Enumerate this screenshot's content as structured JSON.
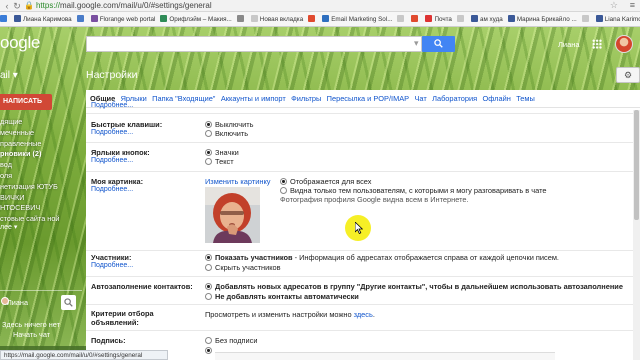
{
  "browser": {
    "url_proto": "https://",
    "url_rest": "mail.google.com/mail/u/0/#settings/general",
    "bookmarks": [
      {
        "label": "",
        "color": "#3b7dd8"
      },
      {
        "label": "Лиана Каримова",
        "color": "#3b5998"
      },
      {
        "label": "",
        "color": "#4a7cc8"
      },
      {
        "label": "Florange web portal",
        "color": "#7a4fa0"
      },
      {
        "label": "Орифлэйм – Макия...",
        "color": "#2e8b57"
      },
      {
        "label": "",
        "color": "#8a8a8a"
      },
      {
        "label": "Новая вкладка",
        "color": "#c8c8c8"
      },
      {
        "label": "",
        "color": "#e04a2f"
      },
      {
        "label": "Email Marketing Sol...",
        "color": "#2e6fbf"
      },
      {
        "label": "",
        "color": "#c8c8c8"
      },
      {
        "label": "",
        "color": "#e04a2f"
      },
      {
        "label": "Почта",
        "color": "#d33"
      },
      {
        "label": "",
        "color": "#c8c8c8"
      },
      {
        "label": "ам худа",
        "color": "#3b5998"
      },
      {
        "label": "Марина Брикайло ...",
        "color": "#3b5998"
      },
      {
        "label": "",
        "color": "#c8c8c8"
      },
      {
        "label": "Liana Karimova",
        "color": "#3b5998"
      }
    ],
    "status_url": "https://mail.google.com/mail/u/0/#settings/general"
  },
  "header": {
    "logo": "oogle",
    "user_name": "Лиана",
    "mail_label": "ail ▾",
    "page_title": "Настройки"
  },
  "sidebar": {
    "compose_label": "НАПИСАТЬ",
    "items": [
      {
        "label": "дящие",
        "bold": false
      },
      {
        "label": "меченные",
        "bold": false
      },
      {
        "label": "правленные",
        "bold": false
      },
      {
        "label": "рновики (2)",
        "bold": true
      },
      {
        "label": "вод",
        "bold": false
      },
      {
        "label": "оля",
        "bold": false
      },
      {
        "label": "нетизация ЮТУБ",
        "bold": false
      },
      {
        "label": "ВИЧКИ",
        "bold": false
      },
      {
        "label": "НТОСЕВИЧ",
        "bold": false
      },
      {
        "label": "стовые сайта ной",
        "bold": false
      }
    ],
    "more_label": "лее ▾",
    "hangout_name": "Лиана",
    "nobody_text": "Здесь ничего нет",
    "start_chat": "Начать чат"
  },
  "settings": {
    "tabs": [
      "Общие",
      "Ярлыки",
      "Папка \"Входящие\"",
      "Аккаунты и импорт",
      "Фильтры",
      "Пересылка и POP/IMAP",
      "Чат",
      "Лаборатория",
      "Офлайн",
      "Темы"
    ],
    "more_label": "Подробнее...",
    "rows": {
      "shortcuts": {
        "label": "Быстрые клавиши:",
        "options": [
          "Выключить",
          "Включить"
        ]
      },
      "button_labels": {
        "label": "Ярлыки кнопок:",
        "options": [
          "Значки",
          "Текст"
        ]
      },
      "picture": {
        "label": "Моя картинка:",
        "change_link": "Изменить картинку",
        "option1": "Отображается для всех",
        "option2": "Видна только тем пользователям, с которыми я могу разговаривать в чате",
        "note": "Фотография профиля Google видна всем в Интернете."
      },
      "participants": {
        "label": "Участники:",
        "option1_bold": "Показать участников",
        "option1_rest": " - Информация об адресатах отображается справа от каждой цепочки писем.",
        "option2": "Скрыть участников"
      },
      "autocomplete": {
        "label": "Автозаполнение контактов:",
        "option1": "Добавлять новых адресатов в группу \"Другие контакты\", чтобы в дальнейшем использовать автозаполнение",
        "option2": "Не добавлять контакты автоматически"
      },
      "filter_criteria": {
        "label_line1": "Критерии отбора",
        "label_line2": "объявлений:",
        "text": "Просмотреть и изменить настройки можно ",
        "link": "здесь",
        "tail": "."
      },
      "signature": {
        "label": "Подпись:",
        "option": "Без подписи"
      }
    }
  }
}
